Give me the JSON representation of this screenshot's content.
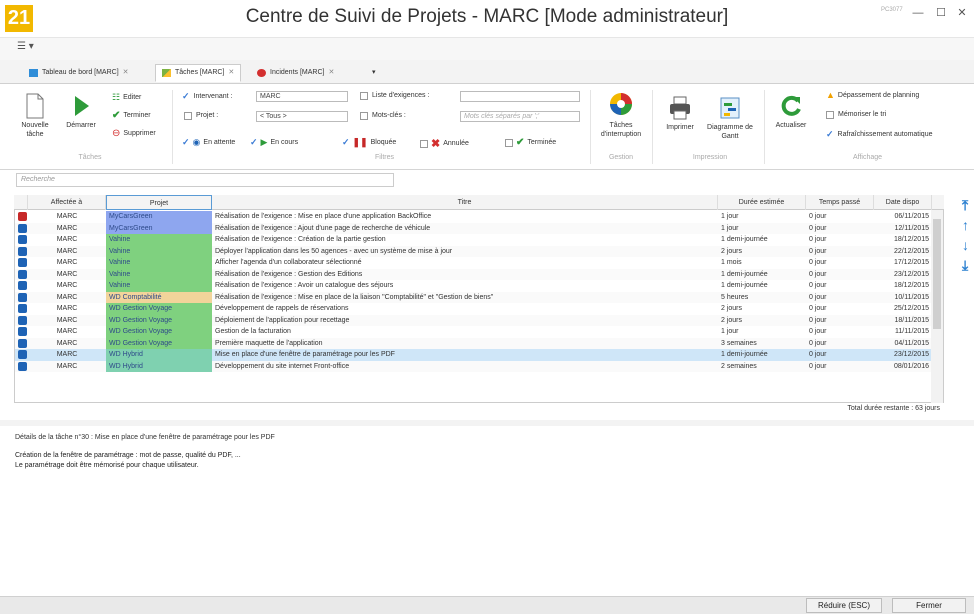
{
  "window": {
    "logo": "21",
    "title": "Centre de Suivi de Projets - MARC [Mode administrateur]",
    "pc_name": "PC3077",
    "minimize": "—",
    "maximize": "☐",
    "close": "✕"
  },
  "menu": {
    "icon": "☰ ▾"
  },
  "tabs": [
    {
      "label": "Tableau de bord [MARC]",
      "close": "✕",
      "color": "#2f8dd8"
    },
    {
      "label": "Tâches [MARC]",
      "close": "✕",
      "color": "#7cb342"
    },
    {
      "label": "Incidents [MARC]",
      "close": "✕",
      "color": "#d32f2f"
    },
    {
      "label": "▾",
      "close": "",
      "color": "#ffffff"
    }
  ],
  "ribbon": {
    "taches": {
      "group": "Tâches",
      "nouvelle": "Nouvelle tâche",
      "demarrer": "Démarrer",
      "editer": "Editer",
      "terminer": "Terminer",
      "supprimer": "Supprimer"
    },
    "filtres": {
      "group": "Filtres",
      "intervenant_label": "Intervenant :",
      "intervenant_value": "MARC",
      "projet_label": "Projet :",
      "projet_value": "< Tous >",
      "exigences_label": "Liste d'exigences :",
      "mots_cles_label": "Mots-clés :",
      "mots_cles_placeholder": "Mots clés séparés par ';'",
      "en_attente": "En attente",
      "en_cours": "En cours",
      "bloquee": "Bloquée",
      "annulee": "Annulée",
      "terminee": "Terminée"
    },
    "gestion": {
      "group": "Gestion",
      "interruption": "Tâches d'interruption"
    },
    "impression": {
      "group": "Impression",
      "imprimer": "Imprimer",
      "gantt": "Diagramme de Gantt"
    },
    "affichage": {
      "group": "Affichage",
      "actualiser": "Actualiser",
      "depassement": "Dépassement de planning",
      "memoriser": "Mémoriser le tri",
      "rafraichissement": "Rafraîchissement automatique"
    }
  },
  "search": {
    "placeholder": "Recherche"
  },
  "grid": {
    "headers": {
      "affectee": "Affectée à",
      "projet": "Projet",
      "titre": "Titre",
      "duree": "Durée estimée",
      "temps": "Temps passé",
      "date": "Date dispo"
    },
    "rows": [
      {
        "icon": "#c62828",
        "affectee": "MARC",
        "projet": "MyCarsGreen",
        "projet_color": "#8ea6ef",
        "titre": "Réalisation de l'exigence : Mise en place d'une application BackOffice",
        "duree": "1 jour",
        "temps": "0 jour",
        "date": "06/11/2015"
      },
      {
        "icon": "#1e63b5",
        "affectee": "MARC",
        "projet": "MyCarsGreen",
        "projet_color": "#8ea6ef",
        "titre": "Réalisation de l'exigence : Ajout d'une page de recherche de véhicule",
        "duree": "1 jour",
        "temps": "0 jour",
        "date": "12/11/2015"
      },
      {
        "icon": "#1e63b5",
        "affectee": "MARC",
        "projet": "Vahine",
        "projet_color": "#7fd17f",
        "titre": "Réalisation de l'exigence : Création de la partie gestion",
        "duree": "1 demi-journée",
        "temps": "0 jour",
        "date": "18/12/2015"
      },
      {
        "icon": "#1e63b5",
        "affectee": "MARC",
        "projet": "Vahine",
        "projet_color": "#7fd17f",
        "titre": "Déployer l'application dans les 50 agences - avec un système de mise à jour",
        "duree": "2 jours",
        "temps": "0 jour",
        "date": "22/12/2015"
      },
      {
        "icon": "#1e63b5",
        "affectee": "MARC",
        "projet": "Vahine",
        "projet_color": "#7fd17f",
        "titre": "Afficher l'agenda d'un collaborateur sélectionné",
        "duree": "1 mois",
        "temps": "0 jour",
        "date": "17/12/2015"
      },
      {
        "icon": "#1e63b5",
        "affectee": "MARC",
        "projet": "Vahine",
        "projet_color": "#7fd17f",
        "titre": "Réalisation de l'exigence : Gestion des Editions",
        "duree": "1 demi-journée",
        "temps": "0 jour",
        "date": "23/12/2015"
      },
      {
        "icon": "#1e63b5",
        "affectee": "MARC",
        "projet": "Vahine",
        "projet_color": "#7fd17f",
        "titre": "Réalisation de l'exigence : Avoir un catalogue des séjours",
        "duree": "1 demi-journée",
        "temps": "0 jour",
        "date": "18/12/2015"
      },
      {
        "icon": "#1e63b5",
        "affectee": "MARC",
        "projet": "WD Comptabilité",
        "projet_color": "#f2d49a",
        "titre": "Réalisation de l'exigence : Mise en place de la liaison \"Comptabilité\" et \"Gestion de biens\"",
        "duree": "5 heures",
        "temps": "0 jour",
        "date": "10/11/2015"
      },
      {
        "icon": "#1e63b5",
        "affectee": "MARC",
        "projet": "WD Gestion Voyage",
        "projet_color": "#7fd17f",
        "titre": "Développement de rappels de réservations",
        "duree": "2 jours",
        "temps": "0 jour",
        "date": "25/12/2015"
      },
      {
        "icon": "#1e63b5",
        "affectee": "MARC",
        "projet": "WD Gestion Voyage",
        "projet_color": "#7fd17f",
        "titre": "Déploiement de l'application pour recettage",
        "duree": "2 jours",
        "temps": "0 jour",
        "date": "18/11/2015"
      },
      {
        "icon": "#1e63b5",
        "affectee": "MARC",
        "projet": "WD Gestion Voyage",
        "projet_color": "#7fd17f",
        "titre": "Gestion de la facturation",
        "duree": "1 jour",
        "temps": "0 jour",
        "date": "11/11/2015"
      },
      {
        "icon": "#1e63b5",
        "affectee": "MARC",
        "projet": "WD Gestion Voyage",
        "projet_color": "#7fd17f",
        "titre": "Première maquette de l'application",
        "duree": "3 semaines",
        "temps": "0 jour",
        "date": "04/11/2015"
      },
      {
        "icon": "#1e63b5",
        "affectee": "MARC",
        "projet": "WD Hybrid",
        "projet_color": "#7fd1b0",
        "titre": "Mise en place d'une fenêtre de paramétrage pour les PDF",
        "duree": "1 demi-journée",
        "temps": "0 jour",
        "date": "23/12/2015",
        "selected": true
      },
      {
        "icon": "#1e63b5",
        "affectee": "MARC",
        "projet": "WD Hybrid",
        "projet_color": "#7fd1b0",
        "titre": "Développement du site internet Front-office",
        "duree": "2 semaines",
        "temps": "0 jour",
        "date": "08/01/2016"
      }
    ],
    "total": "Total durée restante : 63 jours"
  },
  "details": {
    "title": "Détails de la tâche n°30 : Mise en place d'une fenêtre de paramétrage pour les PDF",
    "line1": "Création de la fenêtre de paramétrage : mot de passe, qualité du PDF, ...",
    "line2": "Le paramétrage doit être mémorisé pour chaque utilisateur."
  },
  "footer": {
    "reduire": "Réduire (ESC)",
    "fermer": "Fermer"
  }
}
